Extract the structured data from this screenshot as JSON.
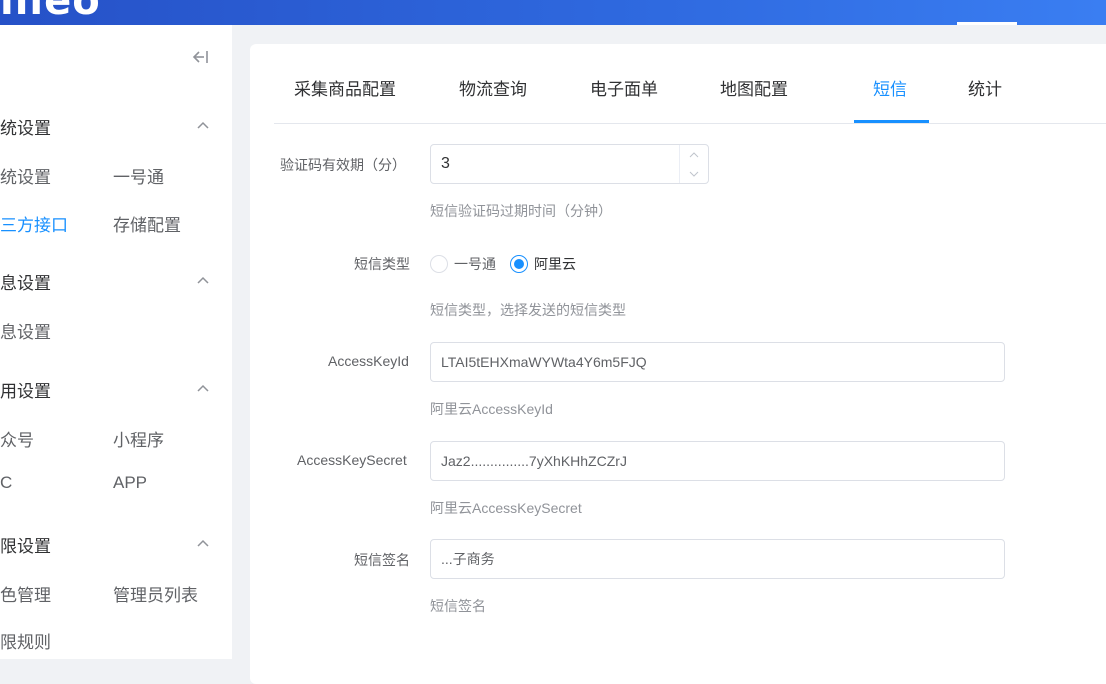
{
  "header": {
    "brand": "illeo"
  },
  "sidebar": {
    "groups": [
      {
        "title": "统设置",
        "items": [
          "统设置",
          "一号通",
          "三方接口",
          "存储配置"
        ],
        "active": "三方接口"
      },
      {
        "title": "息设置",
        "items": [
          "息设置"
        ]
      },
      {
        "title": "用设置",
        "items": [
          "众号",
          "小程序",
          "C",
          "APP"
        ]
      },
      {
        "title": "限设置",
        "items": [
          "色管理",
          "管理员列表",
          "限规则"
        ]
      }
    ]
  },
  "tabs": {
    "items": [
      "采集商品配置",
      "物流查询",
      "电子面单",
      "地图配置",
      "短信",
      "统计"
    ],
    "active": "短信"
  },
  "form": {
    "expiry": {
      "label": "验证码有效期（分）",
      "value": "3",
      "hint": "短信验证码过期时间（分钟）"
    },
    "sms_type": {
      "label": "短信类型",
      "options": [
        "一号通",
        "阿里云"
      ],
      "selected": "阿里云",
      "hint": "短信类型，选择发送的短信类型"
    },
    "access_key_id": {
      "label": "AccessKeyId",
      "value": "LTAI5tEHXmaWYWta4Y6m5FJQ",
      "hint": "阿里云AccessKeyId"
    },
    "access_key_secret": {
      "label": "AccessKeySecret",
      "value": "Jaz2...............7yXhKHhZCZrJ",
      "hint": "阿里云AccessKeySecret"
    },
    "sign_name": {
      "label": "短信签名",
      "value": "...子商务",
      "hint": "短信签名"
    }
  },
  "colors": {
    "primary": "#1890ff",
    "header": "#2f6ae0"
  }
}
